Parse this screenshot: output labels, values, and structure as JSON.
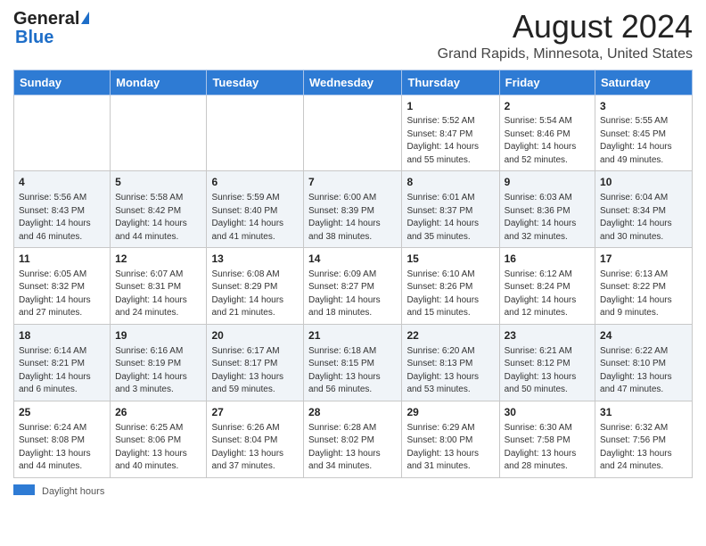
{
  "header": {
    "logo_general": "General",
    "logo_blue": "Blue",
    "main_title": "August 2024",
    "subtitle": "Grand Rapids, Minnesota, United States"
  },
  "days_of_week": [
    "Sunday",
    "Monday",
    "Tuesday",
    "Wednesday",
    "Thursday",
    "Friday",
    "Saturday"
  ],
  "weeks": [
    [
      {
        "day": "",
        "info": ""
      },
      {
        "day": "",
        "info": ""
      },
      {
        "day": "",
        "info": ""
      },
      {
        "day": "",
        "info": ""
      },
      {
        "day": "1",
        "info": "Sunrise: 5:52 AM\nSunset: 8:47 PM\nDaylight: 14 hours and 55 minutes."
      },
      {
        "day": "2",
        "info": "Sunrise: 5:54 AM\nSunset: 8:46 PM\nDaylight: 14 hours and 52 minutes."
      },
      {
        "day": "3",
        "info": "Sunrise: 5:55 AM\nSunset: 8:45 PM\nDaylight: 14 hours and 49 minutes."
      }
    ],
    [
      {
        "day": "4",
        "info": "Sunrise: 5:56 AM\nSunset: 8:43 PM\nDaylight: 14 hours and 46 minutes."
      },
      {
        "day": "5",
        "info": "Sunrise: 5:58 AM\nSunset: 8:42 PM\nDaylight: 14 hours and 44 minutes."
      },
      {
        "day": "6",
        "info": "Sunrise: 5:59 AM\nSunset: 8:40 PM\nDaylight: 14 hours and 41 minutes."
      },
      {
        "day": "7",
        "info": "Sunrise: 6:00 AM\nSunset: 8:39 PM\nDaylight: 14 hours and 38 minutes."
      },
      {
        "day": "8",
        "info": "Sunrise: 6:01 AM\nSunset: 8:37 PM\nDaylight: 14 hours and 35 minutes."
      },
      {
        "day": "9",
        "info": "Sunrise: 6:03 AM\nSunset: 8:36 PM\nDaylight: 14 hours and 32 minutes."
      },
      {
        "day": "10",
        "info": "Sunrise: 6:04 AM\nSunset: 8:34 PM\nDaylight: 14 hours and 30 minutes."
      }
    ],
    [
      {
        "day": "11",
        "info": "Sunrise: 6:05 AM\nSunset: 8:32 PM\nDaylight: 14 hours and 27 minutes."
      },
      {
        "day": "12",
        "info": "Sunrise: 6:07 AM\nSunset: 8:31 PM\nDaylight: 14 hours and 24 minutes."
      },
      {
        "day": "13",
        "info": "Sunrise: 6:08 AM\nSunset: 8:29 PM\nDaylight: 14 hours and 21 minutes."
      },
      {
        "day": "14",
        "info": "Sunrise: 6:09 AM\nSunset: 8:27 PM\nDaylight: 14 hours and 18 minutes."
      },
      {
        "day": "15",
        "info": "Sunrise: 6:10 AM\nSunset: 8:26 PM\nDaylight: 14 hours and 15 minutes."
      },
      {
        "day": "16",
        "info": "Sunrise: 6:12 AM\nSunset: 8:24 PM\nDaylight: 14 hours and 12 minutes."
      },
      {
        "day": "17",
        "info": "Sunrise: 6:13 AM\nSunset: 8:22 PM\nDaylight: 14 hours and 9 minutes."
      }
    ],
    [
      {
        "day": "18",
        "info": "Sunrise: 6:14 AM\nSunset: 8:21 PM\nDaylight: 14 hours and 6 minutes."
      },
      {
        "day": "19",
        "info": "Sunrise: 6:16 AM\nSunset: 8:19 PM\nDaylight: 14 hours and 3 minutes."
      },
      {
        "day": "20",
        "info": "Sunrise: 6:17 AM\nSunset: 8:17 PM\nDaylight: 13 hours and 59 minutes."
      },
      {
        "day": "21",
        "info": "Sunrise: 6:18 AM\nSunset: 8:15 PM\nDaylight: 13 hours and 56 minutes."
      },
      {
        "day": "22",
        "info": "Sunrise: 6:20 AM\nSunset: 8:13 PM\nDaylight: 13 hours and 53 minutes."
      },
      {
        "day": "23",
        "info": "Sunrise: 6:21 AM\nSunset: 8:12 PM\nDaylight: 13 hours and 50 minutes."
      },
      {
        "day": "24",
        "info": "Sunrise: 6:22 AM\nSunset: 8:10 PM\nDaylight: 13 hours and 47 minutes."
      }
    ],
    [
      {
        "day": "25",
        "info": "Sunrise: 6:24 AM\nSunset: 8:08 PM\nDaylight: 13 hours and 44 minutes."
      },
      {
        "day": "26",
        "info": "Sunrise: 6:25 AM\nSunset: 8:06 PM\nDaylight: 13 hours and 40 minutes."
      },
      {
        "day": "27",
        "info": "Sunrise: 6:26 AM\nSunset: 8:04 PM\nDaylight: 13 hours and 37 minutes."
      },
      {
        "day": "28",
        "info": "Sunrise: 6:28 AM\nSunset: 8:02 PM\nDaylight: 13 hours and 34 minutes."
      },
      {
        "day": "29",
        "info": "Sunrise: 6:29 AM\nSunset: 8:00 PM\nDaylight: 13 hours and 31 minutes."
      },
      {
        "day": "30",
        "info": "Sunrise: 6:30 AM\nSunset: 7:58 PM\nDaylight: 13 hours and 28 minutes."
      },
      {
        "day": "31",
        "info": "Sunrise: 6:32 AM\nSunset: 7:56 PM\nDaylight: 13 hours and 24 minutes."
      }
    ]
  ],
  "footer": {
    "daylight_label": "Daylight hours"
  }
}
